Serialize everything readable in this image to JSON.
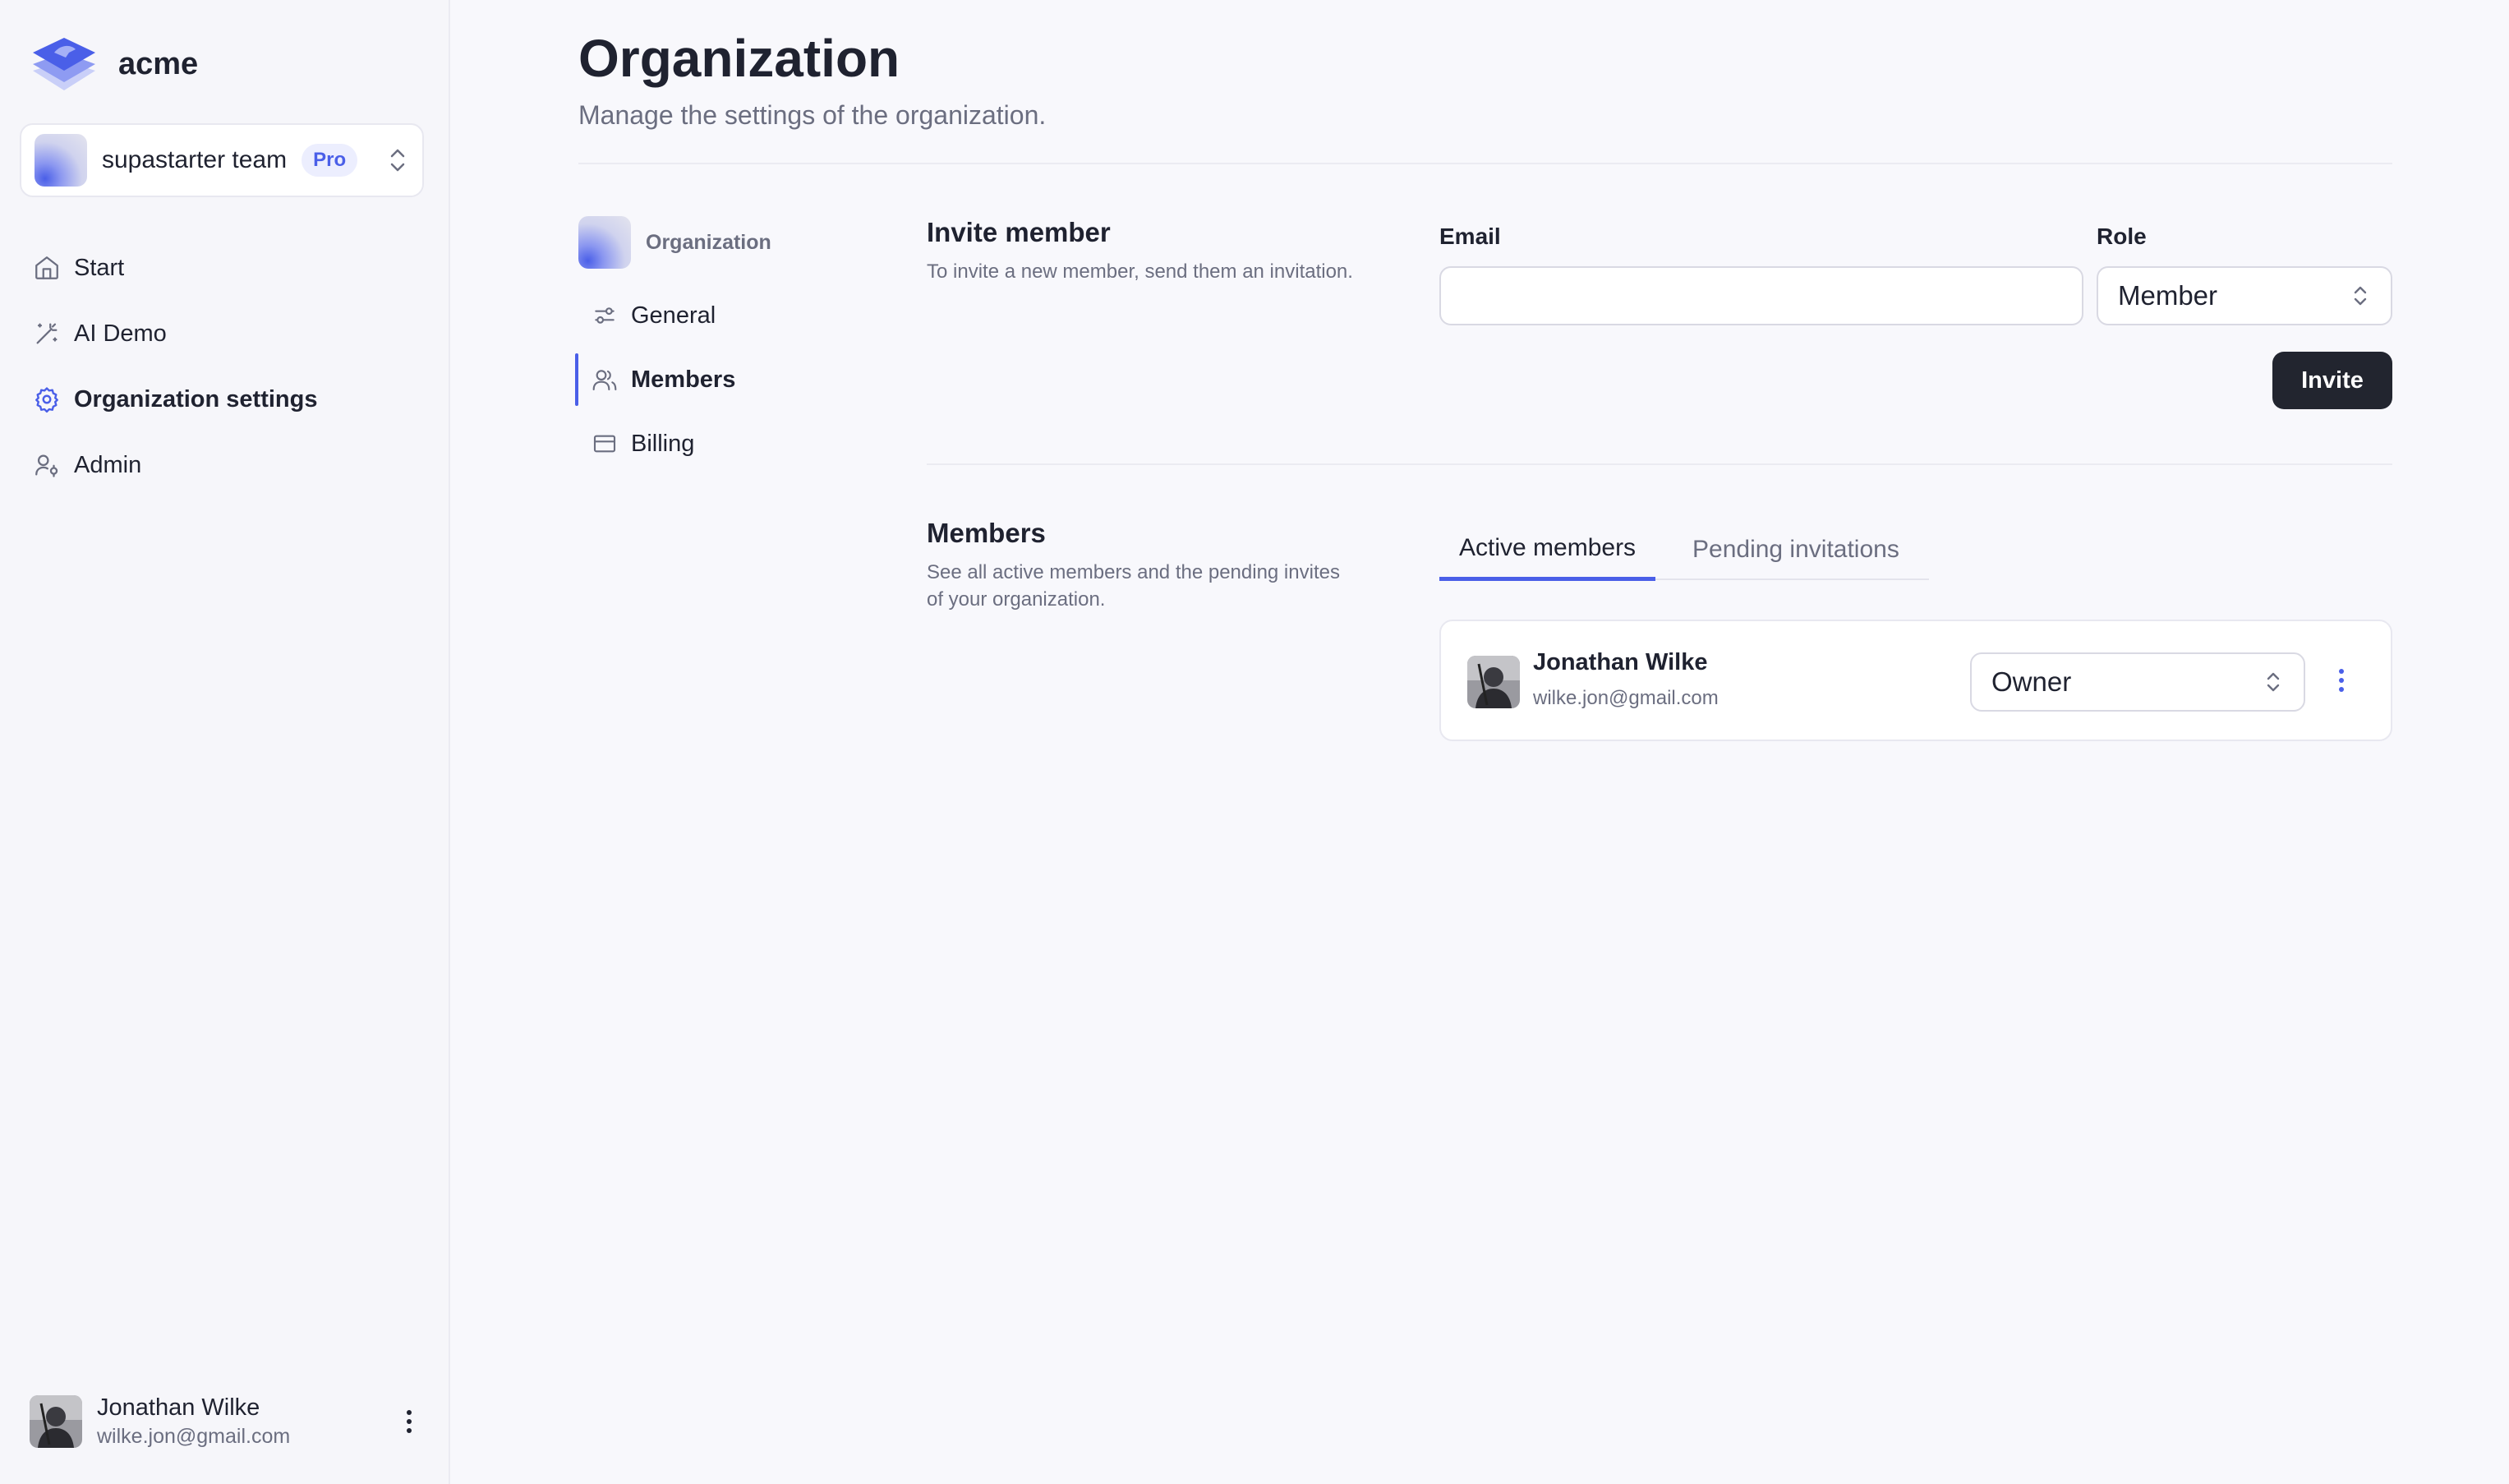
{
  "app": {
    "name": "acme"
  },
  "team": {
    "name": "supastarter team",
    "plan_badge": "Pro"
  },
  "sidebar": {
    "items": [
      {
        "label": "Start",
        "icon": "home-icon"
      },
      {
        "label": "AI Demo",
        "icon": "magic-wand-icon"
      },
      {
        "label": "Organization settings",
        "icon": "gear-icon",
        "active": true
      },
      {
        "label": "Admin",
        "icon": "user-cog-icon"
      }
    ]
  },
  "user": {
    "name": "Jonathan Wilke",
    "email": "wilke.jon@gmail.com"
  },
  "page": {
    "title": "Organization",
    "subtitle": "Manage the settings of the organization."
  },
  "subnav": {
    "header": "Organization",
    "items": [
      {
        "label": "General",
        "icon": "sliders-icon"
      },
      {
        "label": "Members",
        "icon": "users-icon",
        "active": true
      },
      {
        "label": "Billing",
        "icon": "credit-card-icon"
      }
    ]
  },
  "invite": {
    "title": "Invite member",
    "description": "To invite a new member, send them an invitation.",
    "email_label": "Email",
    "email_value": "",
    "role_label": "Role",
    "role_value": "Member",
    "button_label": "Invite"
  },
  "members": {
    "title": "Members",
    "description": "See all active members and the pending invites of your organization.",
    "tabs": [
      "Active members",
      "Pending invitations"
    ],
    "list": [
      {
        "name": "Jonathan Wilke",
        "email": "wilke.jon@gmail.com",
        "role": "Owner"
      }
    ]
  },
  "colors": {
    "accent": "#4a5fe8",
    "primary_button": "#22252f",
    "text": "#1f2230",
    "muted": "#6b6e80"
  }
}
